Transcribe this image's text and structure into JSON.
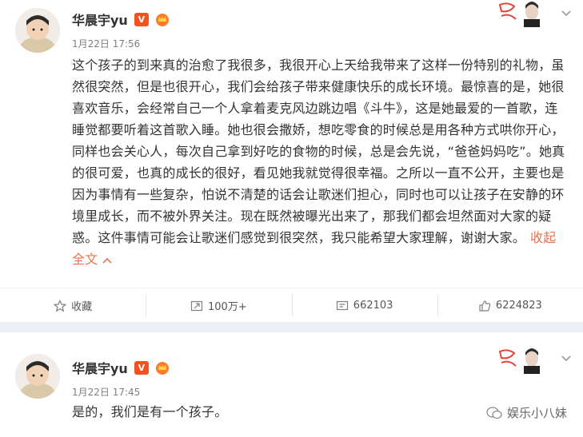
{
  "posts": [
    {
      "user": {
        "name": "华晨宇yu",
        "vip_badge": "V"
      },
      "time": "1月22日 17:56",
      "content": "这个孩子的到来真的治愈了我很多，我很开心上天给我带来了这样一份特别的礼物，虽然很突然，但是也很开心，我们会给孩子带来健康快乐的成长环境。最惊喜的是，她很喜欢音乐，会经常自己一个人拿着麦克风边跳边唱《斗牛》，这是她最爱的一首歌，连睡觉都要听着这首歌入睡。她也很会撒娇，想吃零食的时候总是用各种方式哄你开心，同样也会关心人，每次自己拿到好吃的食物的时候，总是会先说，“爸爸妈妈吃”。她真的很可爱，也真的成长的很好，看见她我就觉得很幸福。之所以一直不公开，主要也是因为事情有一些复杂，怕说不清楚的话会让歌迷们担心，同时也可以让孩子在安静的环境里成长，而不被外界关注。现在既然被曝光出来了，那我们都会坦然面对大家的疑惑。这件事情可能会让歌迷们感觉到很突然，我只能希望大家理解，谢谢大家。",
      "collapse_label": "收起全文",
      "actions": {
        "favorite": "收藏",
        "repost": "100万+",
        "comment": "662103",
        "like": "6224823"
      }
    },
    {
      "user": {
        "name": "华晨宇yu",
        "vip_badge": "V"
      },
      "time": "1月22日 17:45",
      "content": "是的，我们是有一个孩子。"
    }
  ],
  "watermark": "娱乐小八妹",
  "colors": {
    "accent": "#eb7350",
    "vip": "#f4511e",
    "divider": "#eaf0f6"
  }
}
